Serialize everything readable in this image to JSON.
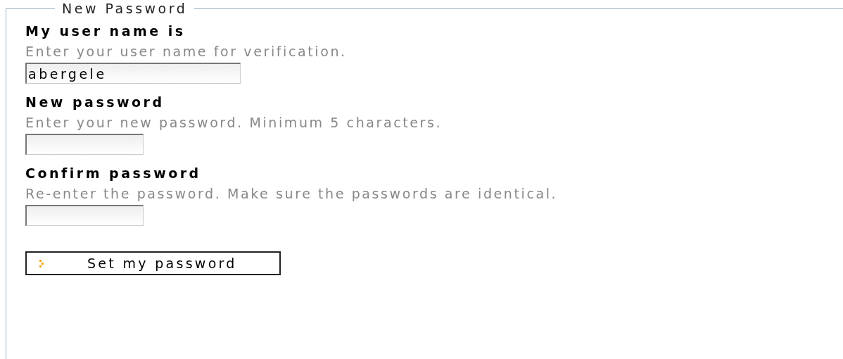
{
  "fieldset": {
    "legend": "New Password"
  },
  "fields": [
    {
      "label": "My user name is",
      "hint": "Enter your user name for verification.",
      "value": "abergele",
      "kind": "text"
    },
    {
      "label": "New password",
      "hint": "Enter your new password. Minimum 5 characters.",
      "kind": "password"
    },
    {
      "label": "Confirm password",
      "hint": "Re-enter the password. Make sure the passwords are identical.",
      "kind": "password"
    }
  ],
  "submit": {
    "label": "Set my password"
  }
}
